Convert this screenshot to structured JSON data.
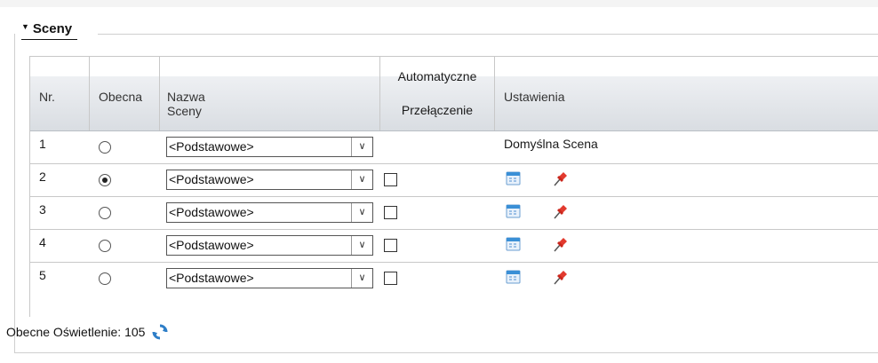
{
  "section": {
    "title": "Sceny"
  },
  "table": {
    "headers": {
      "nr": "Nr.",
      "current": "Obecna",
      "scene_name": "Nazwa Sceny",
      "auto_switch_line1": "Automatyczne",
      "auto_switch_line2": "Przełączenie",
      "settings": "Ustawienia"
    },
    "rows": [
      {
        "nr": "1",
        "current": false,
        "scene_name": "<Podstawowe>",
        "auto_switch": null,
        "settings_text": "Domyślna Scena"
      },
      {
        "nr": "2",
        "current": true,
        "scene_name": "<Podstawowe>",
        "auto_switch": false,
        "settings_icons": [
          "calendar-icon",
          "pin-icon"
        ]
      },
      {
        "nr": "3",
        "current": false,
        "scene_name": "<Podstawowe>",
        "auto_switch": false,
        "settings_icons": [
          "calendar-icon",
          "pin-icon"
        ]
      },
      {
        "nr": "4",
        "current": false,
        "scene_name": "<Podstawowe>",
        "auto_switch": false,
        "settings_icons": [
          "calendar-icon",
          "pin-icon"
        ]
      },
      {
        "nr": "5",
        "current": false,
        "scene_name": "<Podstawowe>",
        "auto_switch": false,
        "settings_icons": [
          "calendar-icon",
          "pin-icon"
        ]
      }
    ]
  },
  "footer": {
    "illumination_label": "Obecne Oświetlenie: 105",
    "refresh_icon": "refresh-icon"
  },
  "colors": {
    "header_gradient_top": "#eef0f3",
    "header_gradient_bottom": "#d9dde2",
    "pin_red": "#e23a2e",
    "calendar_blue": "#3a8fd6",
    "refresh_blue": "#2f7fc8"
  }
}
